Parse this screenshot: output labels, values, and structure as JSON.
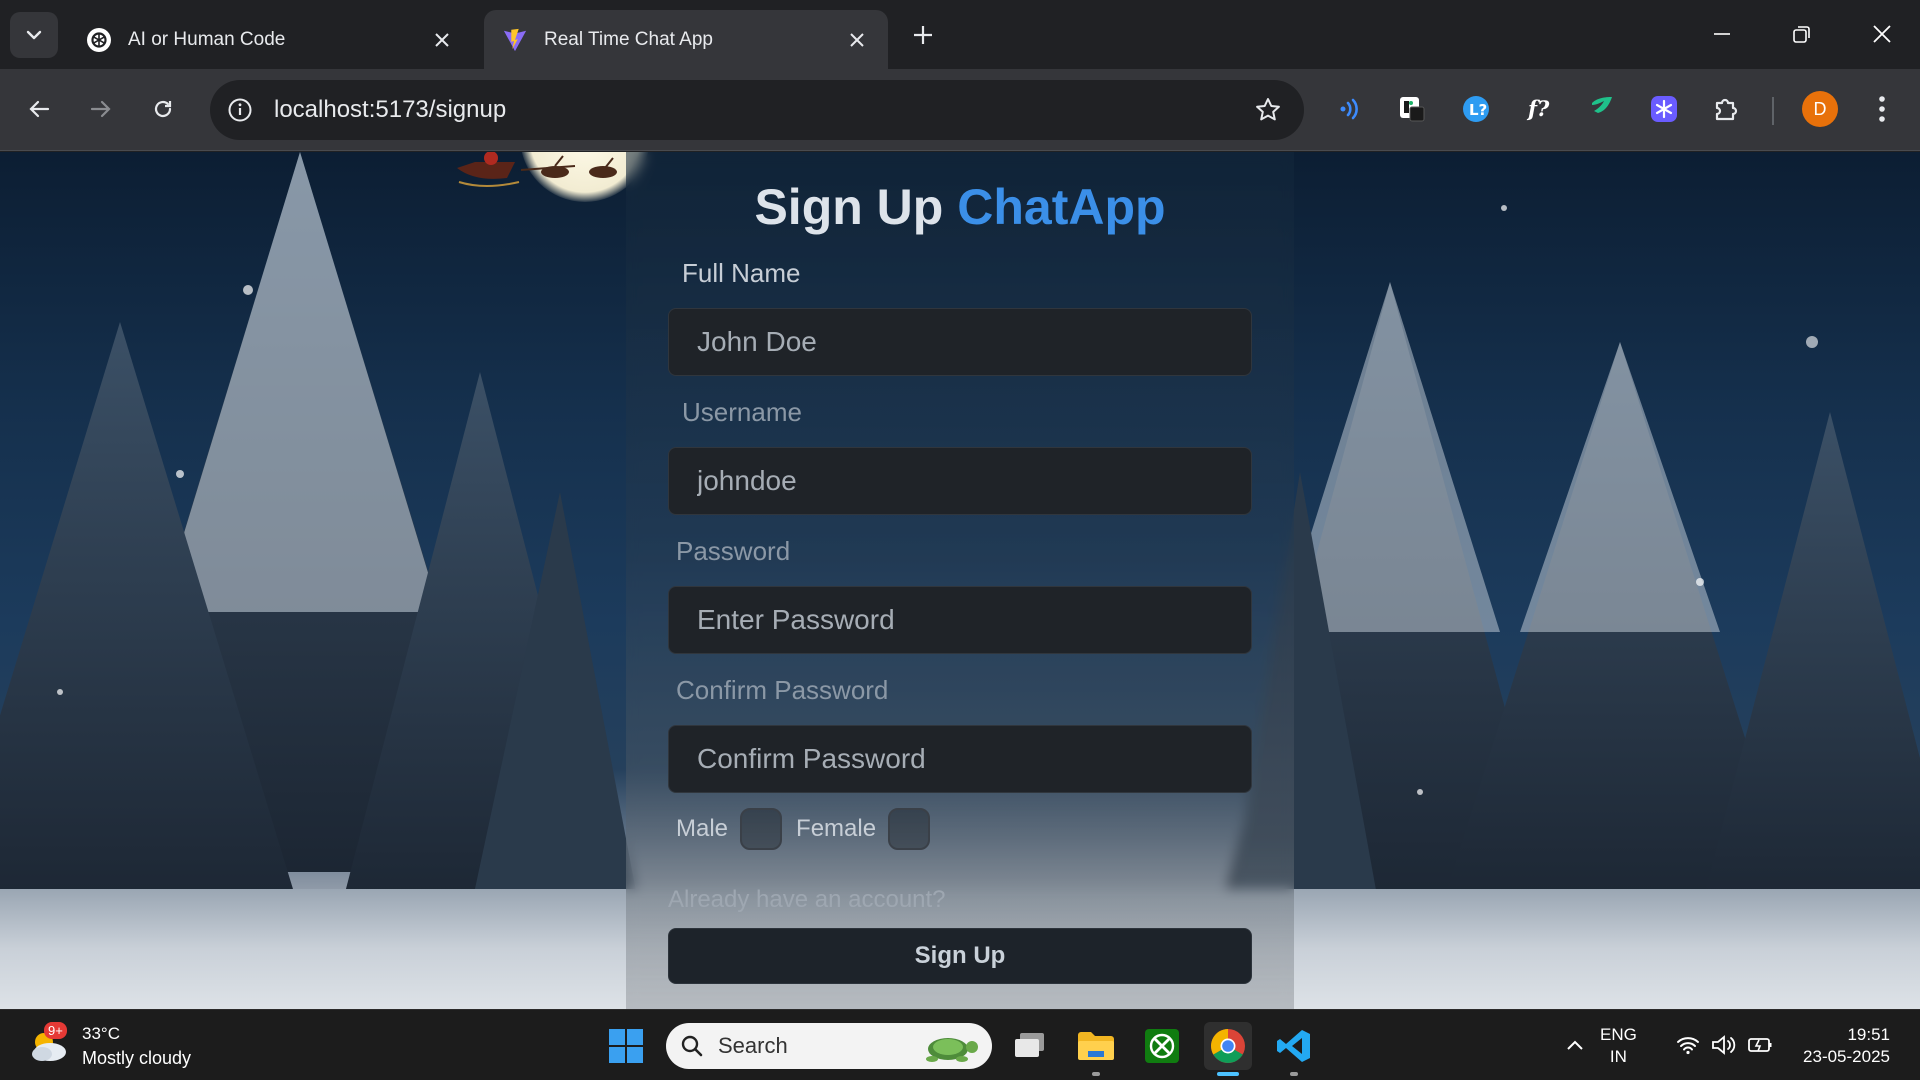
{
  "browser": {
    "tabs": [
      {
        "title": "AI or Human Code",
        "icon": "openai-icon",
        "active": false
      },
      {
        "title": "Real Time Chat App",
        "icon": "vite-icon",
        "active": true
      }
    ],
    "url": "localhost:5173/signup",
    "profile_initial": "D",
    "extensions": [
      "wave-extension-icon",
      "notion-clipper-icon",
      "l-question-icon",
      "f-question-icon",
      "feather-icon",
      "snowflake-extension-icon",
      "puzzle-extensions-icon"
    ]
  },
  "page": {
    "title_prefix": "Sign Up",
    "brand": "ChatApp",
    "fields": {
      "fullname_label": "Full Name",
      "fullname_placeholder": "John Doe",
      "username_label": "Username",
      "username_placeholder": "johndoe",
      "password_label": "Password",
      "password_placeholder": "Enter Password",
      "confirm_label": "Confirm Password",
      "confirm_placeholder": "Confirm Password"
    },
    "gender": {
      "male": "Male",
      "female": "Female"
    },
    "login_link": "Already have an account?",
    "submit": "Sign Up"
  },
  "taskbar": {
    "weather_badge": "9+",
    "temperature": "33°C",
    "condition": "Mostly cloudy",
    "search": "Search",
    "language_top": "ENG",
    "language_bottom": "IN",
    "time": "19:51",
    "date": "23-05-2025"
  },
  "colors": {
    "brand": "#3b8fe8",
    "chrome_bg": "#202124",
    "toolbar_bg": "#35363a",
    "profile": "#e8710a"
  }
}
